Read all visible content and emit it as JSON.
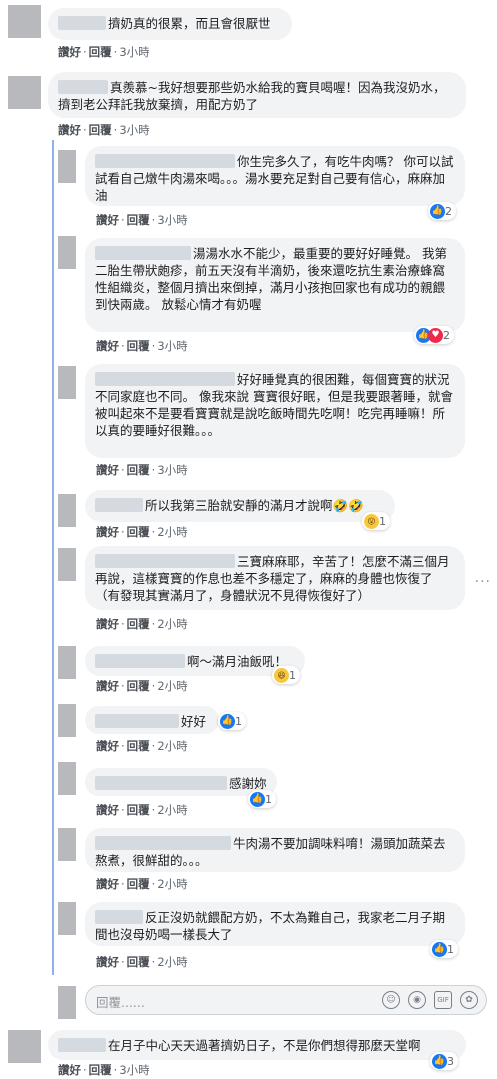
{
  "comments": [
    {
      "text": "擠奶真的很累，而且會很厭世",
      "like": "讚好",
      "reply": "回覆",
      "time": "3小時"
    },
    {
      "text": "真羨慕~我好想要那些奶水給我的寶貝喝喔！因為我沒奶水，擠到老公拜託我放棄擠，用配方奶了",
      "like": "讚好",
      "reply": "回覆",
      "time": "3小時"
    },
    {
      "text": "你生完多久了，有吃牛肉嗎？ 你可以試試看自己燉牛肉湯來喝。。。湯水要充足對自己要有信心，麻麻加油",
      "like": "讚好",
      "reply": "回覆",
      "time": "3小時",
      "reaction_count": "2"
    },
    {
      "text": "湯湯水水不能少，最重要的要好好睡覺。 我第二胎生帶狀皰疹，前五天沒有半滴奶，後來還吃抗生素治療蜂窩性組織炎，整個月擠出來倒掉，滿月小孩抱回家也有成功的親餵到快兩歲。 放鬆心情才有奶喔",
      "like": "讚好",
      "reply": "回覆",
      "time": "3小時",
      "reaction_count": "2"
    },
    {
      "text": "好好睡覺真的很困難，每個寶寶的狀況不同家庭也不同。 像我來說 寶寶很好眠，但是我要跟著睡，就會被叫起來不是要看寶寶就是說吃飯時間先吃啊！吃完再睡嘛！所以真的要睡好很難。。。",
      "like": "讚好",
      "reply": "回覆",
      "time": "3小時"
    },
    {
      "text": "所以我第三胎就安靜的滿月才說啊🤣🤣",
      "like": "讚好",
      "reply": "回覆",
      "time": "2小時",
      "reaction_count": "1"
    },
    {
      "text": "三寶麻麻耶，辛苦了！怎麼不滿三個月再說，這樣寶寶的作息也差不多穩定了，麻麻的身體也恢復了（有發現其實滿月了，身體狀況不見得恢復好了）",
      "like": "讚好",
      "reply": "回覆",
      "time": "2小時"
    },
    {
      "text": "啊～滿月油飯吼！",
      "like": "讚好",
      "reply": "回覆",
      "time": "2小時",
      "reaction_count": "1"
    },
    {
      "text": "好好",
      "like": "讚好",
      "reply": "回覆",
      "time": "2小時",
      "reaction_count": "1"
    },
    {
      "text": "感謝妳",
      "like": "讚好",
      "reply": "回覆",
      "time": "2小時",
      "reaction_count": "1"
    },
    {
      "text": "牛肉湯不要加調味料唷！湯頭加蔬菜去熬煮，很鮮甜的。。。",
      "like": "讚好",
      "reply": "回覆",
      "time": "2小時"
    },
    {
      "text": "反正沒奶就餵配方奶，不太為難自己，我家老二月子期間也沒母奶喝一樣長大了",
      "like": "讚好",
      "reply": "回覆",
      "time": "2小時",
      "reaction_count": "1"
    },
    {
      "text": "在月子中心天天過著擠奶日子，不是你們想得那麼天堂啊",
      "like": "讚好",
      "reply": "回覆",
      "time": "3小時",
      "reaction_count": "3"
    }
  ],
  "reply_box": {
    "placeholder": "回覆......"
  },
  "icons": {
    "more": "more-options-icon",
    "like": "like-icon",
    "love": "love-icon",
    "haha": "haha-icon",
    "wow": "wow-icon"
  },
  "colors": {
    "link_blue": "#1877f2",
    "bubble": "#f2f3f5",
    "thread": "#8fb0e8"
  }
}
